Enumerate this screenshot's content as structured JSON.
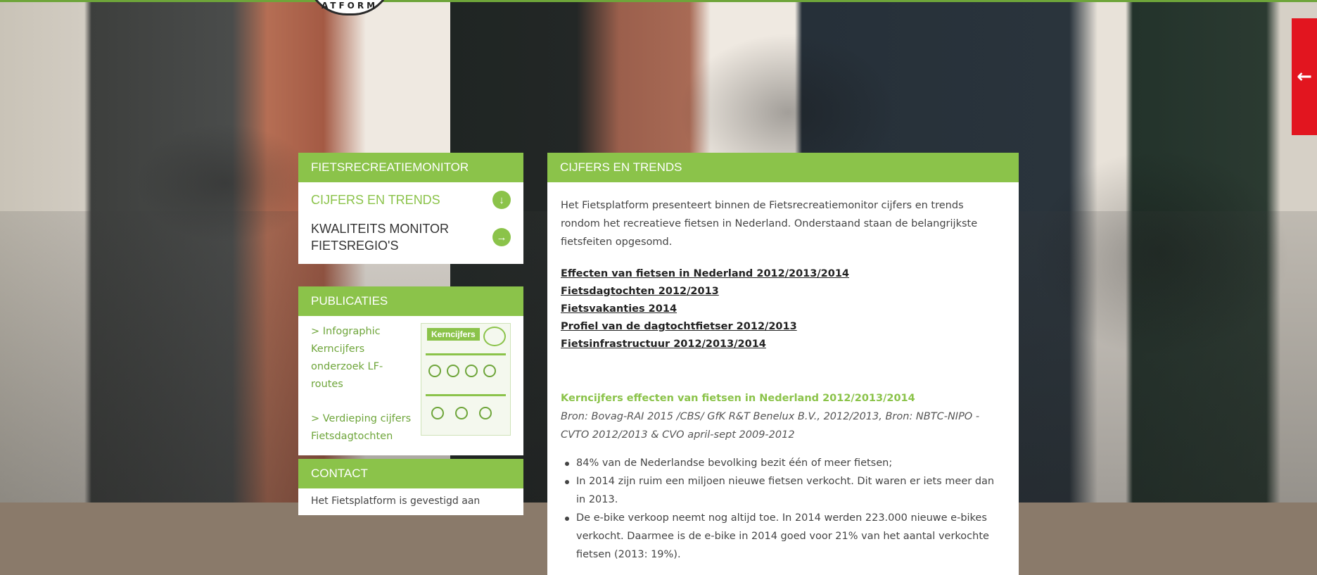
{
  "brand": {
    "logo_text": "ATFORM"
  },
  "colors": {
    "green": "#8bc34a",
    "dark_green": "#6ea53a",
    "red": "#e2151f"
  },
  "side_tab": {
    "icon": "arrow-left-icon",
    "glyph": "←"
  },
  "nav": {
    "header": "FIETSRECREATIEMONITOR",
    "items": [
      {
        "label": "CIJFERS EN TRENDS",
        "icon": "arrow-down-circle-icon",
        "glyph": "↓",
        "active": true
      },
      {
        "label": "KWALITEITS MONITOR FIETSREGIO'S",
        "icon": "arrow-right-circle-icon",
        "glyph": "→",
        "active": false
      }
    ]
  },
  "publicaties": {
    "header": "PUBLICATIES",
    "links": [
      {
        "label": "> Infographic Kerncijfers onderzoek LF-routes"
      },
      {
        "label": "> Verdieping cijfers Fietsdagtochten"
      }
    ],
    "thumb_title": "Kerncijfers"
  },
  "contact": {
    "header": "CONTACT",
    "text": "Het Fietsplatform is gevestigd aan"
  },
  "main": {
    "header": "CIJFERS EN TRENDS",
    "intro": "Het Fietsplatform presenteert binnen de Fietsrecreatiemonitor cijfers en trends rondom het recreatieve fietsen in Nederland. Onderstaand staan de belangrijkste fietsfeiten opgesomd.",
    "links": [
      "Effecten van fietsen in Nederland 2012/2013/2014",
      "Fietsdagtochten 2012/2013",
      "Fietsvakanties 2014",
      "Profiel van de dagtochtfietser 2012/2013",
      "Fietsinfrastructuur 2012/2013/2014"
    ],
    "section_title": "Kerncijfers effecten van fietsen in Nederland 2012/2013/2014",
    "source": "Bron: Bovag-RAI 2015 /CBS/ GfK R&T Benelux  B.V., 2012/2013, Bron: NBTC-NIPO - CVTO 2012/2013 & CVO april-sept 2009-2012",
    "bullets": [
      "84% van de Nederlandse bevolking bezit één of meer fietsen;",
      "In 2014 zijn ruim een miljoen nieuwe fietsen verkocht. Dit waren er iets meer dan in 2013.",
      "De e-bike verkoop neemt nog altijd toe. In 2014 werden 223.000 nieuwe e-bikes verkocht. Daarmee is de e-bike in 2014 goed voor 21% van het aantal verkochte fietsen (2013: 19%)."
    ]
  }
}
